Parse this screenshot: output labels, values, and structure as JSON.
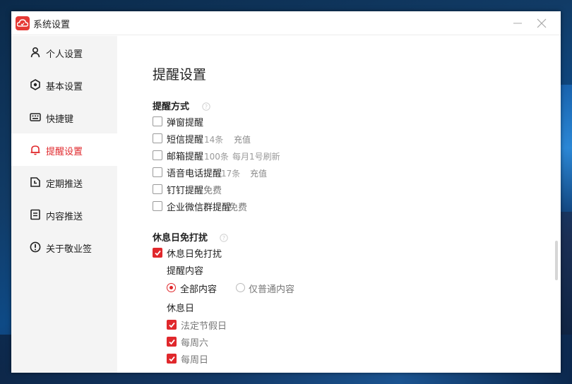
{
  "window": {
    "title": "系统设置",
    "accent_color": "#e0282c"
  },
  "sidebar": {
    "items": [
      {
        "label": "个人设置",
        "icon": "user-icon"
      },
      {
        "label": "基本设置",
        "icon": "gear-icon"
      },
      {
        "label": "快捷键",
        "icon": "keyboard-icon"
      },
      {
        "label": "提醒设置",
        "icon": "bell-icon",
        "active": true
      },
      {
        "label": "定期推送",
        "icon": "clock-icon"
      },
      {
        "label": "内容推送",
        "icon": "document-icon"
      },
      {
        "label": "关于敬业签",
        "icon": "info-icon"
      }
    ]
  },
  "main": {
    "title": "提醒设置",
    "reminder_methods": {
      "title": "提醒方式",
      "options": [
        {
          "label": "弹窗提醒",
          "checked": false
        },
        {
          "label": "短信提醒",
          "meta": "14条",
          "link": "充值",
          "checked": false
        },
        {
          "label": "邮箱提醒",
          "meta": "100条",
          "meta2": "每月1号刷新",
          "checked": false
        },
        {
          "label": "语音电话提醒",
          "meta": "17条",
          "link": "充值",
          "checked": false
        },
        {
          "label": "钉钉提醒",
          "note": "免费",
          "checked": false
        },
        {
          "label": "企业微信群提醒",
          "note": "免费",
          "checked": false
        }
      ]
    },
    "rest_day": {
      "title": "休息日免打扰",
      "enable_label": "休息日免打扰",
      "enabled": true,
      "content_label": "提醒内容",
      "content_options": [
        {
          "label": "全部内容",
          "selected": true
        },
        {
          "label": "仅普通内容",
          "selected": false
        }
      ],
      "days_label": "休息日",
      "days": [
        {
          "label": "法定节假日",
          "checked": true
        },
        {
          "label": "每周六",
          "checked": true
        },
        {
          "label": "每周日",
          "checked": true
        }
      ]
    }
  }
}
